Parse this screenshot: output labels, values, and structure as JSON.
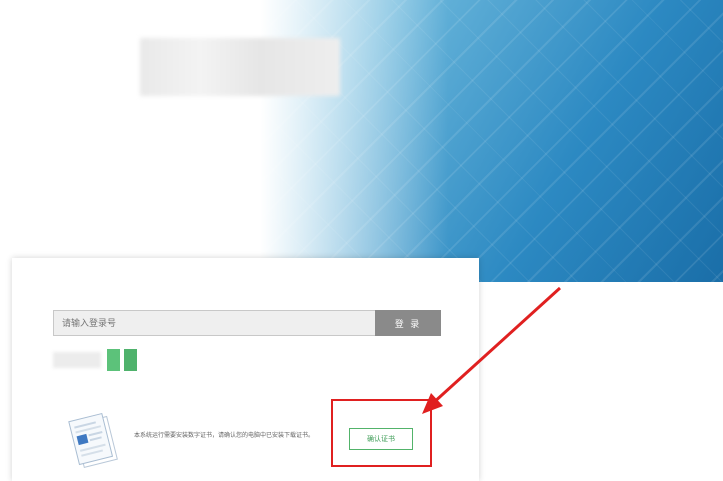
{
  "hero": {
    "logo": ""
  },
  "login": {
    "input_placeholder": "请输入登录号",
    "login_button": "登 录"
  },
  "plugin_notice": {
    "text": "本系统运行需要安装数字证书，请确认您的电脑中已安装下载证书。",
    "install_button": "确认证书"
  },
  "annotation": {
    "color": "#e02020"
  },
  "colors": {
    "accent_green": "#52b36a",
    "banner_blue": "#2c89c2"
  }
}
